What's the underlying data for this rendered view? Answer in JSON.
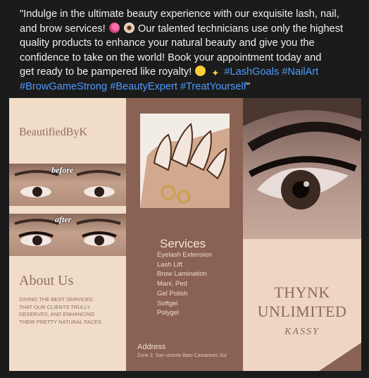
{
  "post": {
    "line1": "\"Indulge in the ultimate beauty experience with our exquisite lash, nail,",
    "line2a": "and brow services!",
    "line2b": "Our talented technicians use only the highest",
    "line3": "quality products to enhance your natural beauty and give you the",
    "line4": "confidence to take on the world! Book your appointment today and",
    "line5": "get ready to be pampered like royalty!",
    "hashtags_line5": "#LashGoals #NailArt",
    "hashtags_line6": "#BrowGameStrong #BeautyExpert #TreatYourself",
    "closing_quote": "\""
  },
  "flyer": {
    "brand": "BeautifiedByK",
    "before_label": "before",
    "after_label": "after",
    "about_title": "About Us",
    "about_body": "GIVING THE BEST SERVICES THAT OUR CLIENTS TRULLY DESERVES, AND ENHANCING THEIR PRETTY NATURAL FACES",
    "services_title": "Services",
    "services": [
      "Eyelash Extension",
      "Lash Lift",
      "Brow Lamination",
      "Mani, Ped",
      "Gel Polish",
      "Softgel",
      "Polygel"
    ],
    "address_title": "Address",
    "address_body": "Zone 2, San vicente Bato Camarines Sur",
    "company_line1": "THYNK",
    "company_line2": "UNLIMITED",
    "signature": "KASSY"
  },
  "colors": {
    "background": "#1b1b1b",
    "text": "#f0f0f0",
    "hashtag": "#4d9bff",
    "flyer_cream": "#f0dcc7",
    "flyer_brown": "#8a6253",
    "flyer_text": "#8e7064"
  },
  "icons": [
    "nail-polish-emoji",
    "eye-emoji",
    "star-struck-emoji",
    "sparkles-emoji"
  ]
}
